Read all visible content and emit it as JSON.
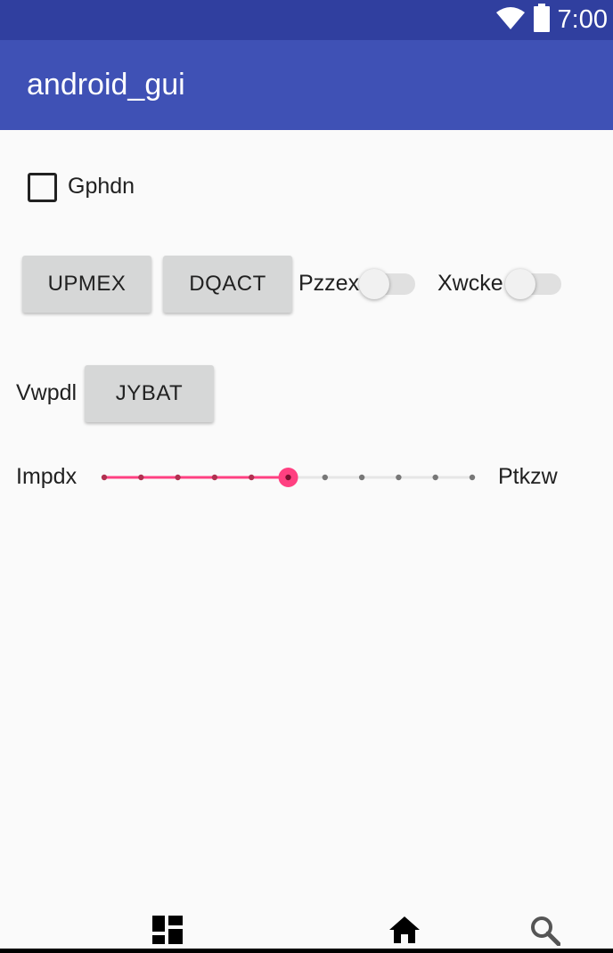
{
  "status_bar": {
    "time": "7:00",
    "icons": [
      "wifi-icon",
      "battery-icon"
    ]
  },
  "app_bar": {
    "title": "android_gui"
  },
  "form": {
    "checkbox_label": "Gphdn",
    "checkbox_checked": false,
    "button_1": "UPMEX",
    "button_2": "DQACT",
    "switch_1_label": "Pzzex",
    "switch_1_on": false,
    "switch_2_label": "Xwcke",
    "switch_2_on": false,
    "row3_label": "Vwpdl",
    "button_3": "JYBAT",
    "seek_left_label": "Impdx",
    "seek_right_label": "Ptkzw",
    "seek_steps": 10,
    "seek_value": 5
  },
  "colors": {
    "status_bar": "#303f9f",
    "app_bar": "#3f51b5",
    "accent": "#ff4081",
    "button": "#d6d7d7",
    "background": "#fafafa"
  },
  "nav": {
    "icons": [
      "dashboard-icon",
      "home-icon",
      "search-icon"
    ]
  }
}
